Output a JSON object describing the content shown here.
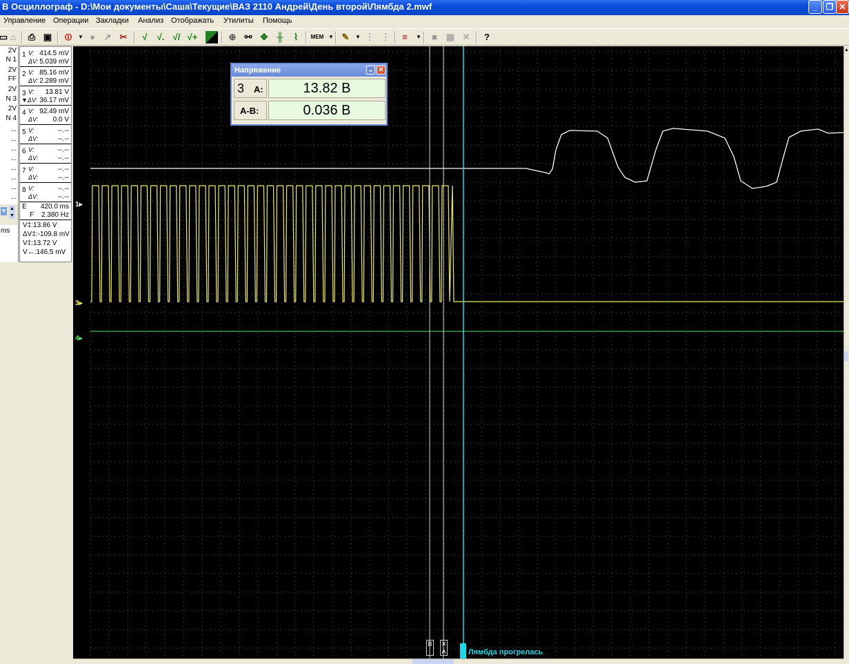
{
  "window": {
    "title": "В Осциллограф - D:\\Мои документы\\Саша\\Текущие\\ВАЗ 2110 Андрей\\День второй\\Лямбда 2.mwf",
    "min_glyph": "_",
    "max_glyph": "❐",
    "close_glyph": "✕"
  },
  "menu": [
    "Управление",
    "Операции",
    "Закладки",
    "Анализ",
    "Отображать",
    "Утилиты",
    "Помощь"
  ],
  "toolbar": {
    "check1": "√",
    "check2": "√.",
    "check3": "√/",
    "check4": "√+",
    "mem": "MEM",
    "help": "?"
  },
  "left_panel": [
    "2V",
    "N 1",
    "2V",
    "FF",
    "2V",
    "N 3",
    "2V",
    "N 4",
    "...",
    "...",
    "...",
    "...",
    "...",
    "...",
    "...",
    "...",
    "ms"
  ],
  "channels": [
    {
      "num": "1",
      "v": "414.5 mV",
      "dv": "5.039 mV"
    },
    {
      "num": "2",
      "v": "85.16 mV",
      "dv": "2.289 mV"
    },
    {
      "num": "3",
      "v": "13.81 V",
      "dv": "36.17 mV"
    },
    {
      "num": "4",
      "v": "92.49 mV",
      "dv": "0.0 V"
    },
    {
      "num": "5",
      "v": "--.--",
      "dv": "--.--"
    },
    {
      "num": "6",
      "v": "--.--",
      "dv": "--.--"
    },
    {
      "num": "7",
      "v": "--.--",
      "dv": "--.--"
    },
    {
      "num": "8",
      "v": "--.--",
      "dv": "--.--"
    }
  ],
  "timing": {
    "t": "420.0 ms",
    "f": "2.380 Hz",
    "e_label": "E",
    "f_label": "F"
  },
  "measure": [
    "V‡:13.86 V",
    "ΔV‡:-109.8 mV",
    "V‡:13.72 V",
    "V↔:146.5 mV"
  ],
  "dialog": {
    "title": "Напряжение",
    "channel": "3",
    "a_label": "A:",
    "ab_label": "A-B:",
    "a_value": "13.82 В",
    "ab_value": "0.036 В"
  },
  "trace_markers": [
    {
      "label": "1",
      "color": "#ffffff"
    },
    {
      "label": "3",
      "color": "#f0f060"
    },
    {
      "label": "4",
      "color": "#60e060"
    }
  ],
  "cursor_labels": {
    "b": "B",
    "a": "A"
  },
  "bookmark": "Лямбда прогрелась",
  "colors": {
    "trace1": "#ffffff",
    "trace3": "#f0f060",
    "trace4": "#60e060",
    "cursor_main": "#19d8e8",
    "grid": "#555555"
  }
}
